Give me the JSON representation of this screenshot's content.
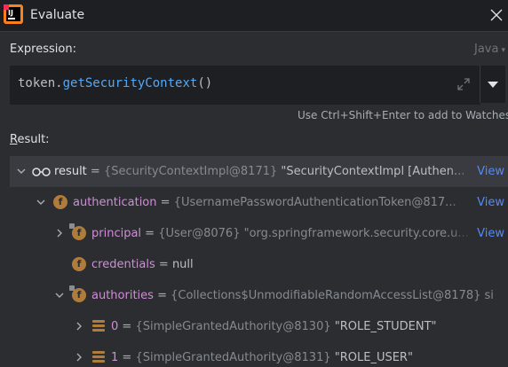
{
  "window": {
    "title": "Evaluate"
  },
  "expression": {
    "label": "Expression:",
    "language": "Java",
    "receiver": "token",
    "dot": ".",
    "method": "getSecurityContext",
    "parens": "()",
    "hint": "Use Ctrl+Shift+Enter to add to Watches"
  },
  "result": {
    "label_rest": "esult:",
    "label_first": "R",
    "rows": [
      {
        "name": "result",
        "eq": " = ",
        "type": "{SecurityContextImpl@8171}",
        "value": " \"SecurityContextImpl [Authen...",
        "link": "View"
      },
      {
        "name": "authentication",
        "eq": " = ",
        "type": "{UsernamePasswordAuthenticationToken@817...",
        "value": "",
        "link": "View",
        "icon": "f"
      },
      {
        "name": "principal",
        "eq": " = ",
        "type": "{User@8076}",
        "value": " \"org.springframework.security.core.u...",
        "link": "View",
        "icon": "f"
      },
      {
        "name": "credentials",
        "eq": " = ",
        "type": "",
        "value": "null",
        "link": "",
        "icon": "f"
      },
      {
        "name": "authorities",
        "eq": " = ",
        "type": "{Collections$UnmodifiableRandomAccessList@8178}",
        "value": "  si",
        "link": "",
        "icon": "f"
      },
      {
        "name": "0",
        "eq": " = ",
        "type": "{SimpleGrantedAuthority@8130}",
        "value": " \"ROLE_STUDENT\"",
        "link": ""
      },
      {
        "name": "1",
        "eq": " = ",
        "type": "{SimpleGrantedAuthority@8131}",
        "value": " \"ROLE_USER\"",
        "link": ""
      }
    ]
  },
  "colors": {
    "background": "#2b2d30",
    "titlebar": "#1e1f22",
    "field_name": "#cf8ed6",
    "type_text": "#868a91",
    "link": "#548af7",
    "method": "#56a8f5",
    "field_icon": "#b07c3c"
  },
  "icons": [
    "app-logo-icon",
    "close-icon",
    "expand-icon",
    "chevron-down-icon",
    "watch-glasses-icon",
    "field-icon",
    "array-element-icon"
  ]
}
